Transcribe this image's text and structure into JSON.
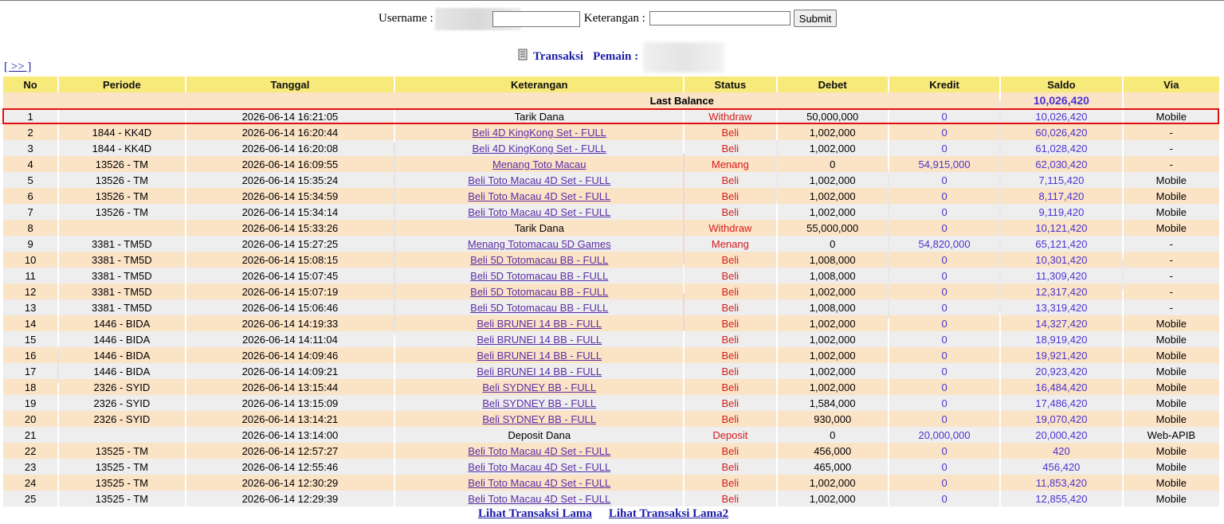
{
  "search": {
    "username_label": "Username :",
    "keterangan_label": "Keterangan :",
    "username_value": "",
    "keterangan_value": "",
    "submit_label": "Submit"
  },
  "title": {
    "transaksi": "Transaksi",
    "pemain": "Pemain :"
  },
  "nav": {
    "next": "[ >> ]"
  },
  "table": {
    "headers": [
      "No",
      "Periode",
      "Tanggal",
      "Keterangan",
      "Status",
      "Debet",
      "Kredit",
      "Saldo",
      "Via"
    ],
    "last_balance_label": "Last Balance",
    "last_balance_value": "10,026,420",
    "rows": [
      {
        "no": "1",
        "periode": "",
        "tanggal": "2026-06-14 16:21:05",
        "ket": "Tarik Dana",
        "link": false,
        "status": "Withdraw",
        "debet": "50,000,000",
        "kredit": "0",
        "saldo": "10,026,420",
        "via": "Mobile"
      },
      {
        "no": "2",
        "periode": "1844 - KK4D",
        "tanggal": "2026-06-14 16:20:44",
        "ket": "Beli 4D KingKong Set - FULL",
        "link": true,
        "status": "Beli",
        "debet": "1,002,000",
        "kredit": "0",
        "saldo": "60,026,420",
        "via": "-"
      },
      {
        "no": "3",
        "periode": "1844 - KK4D",
        "tanggal": "2026-06-14 16:20:08",
        "ket": "Beli 4D KingKong Set - FULL",
        "link": true,
        "status": "Beli",
        "debet": "1,002,000",
        "kredit": "0",
        "saldo": "61,028,420",
        "via": "-"
      },
      {
        "no": "4",
        "periode": "13526 - TM",
        "tanggal": "2026-06-14 16:09:55",
        "ket": "Menang Toto Macau",
        "link": true,
        "status": "Menang",
        "debet": "0",
        "kredit": "54,915,000",
        "saldo": "62,030,420",
        "via": "-"
      },
      {
        "no": "5",
        "periode": "13526 - TM",
        "tanggal": "2026-06-14 15:35:24",
        "ket": "Beli Toto Macau 4D Set - FULL",
        "link": true,
        "status": "Beli",
        "debet": "1,002,000",
        "kredit": "0",
        "saldo": "7,115,420",
        "via": "Mobile"
      },
      {
        "no": "6",
        "periode": "13526 - TM",
        "tanggal": "2026-06-14 15:34:59",
        "ket": "Beli Toto Macau 4D Set - FULL",
        "link": true,
        "status": "Beli",
        "debet": "1,002,000",
        "kredit": "0",
        "saldo": "8,117,420",
        "via": "Mobile"
      },
      {
        "no": "7",
        "periode": "13526 - TM",
        "tanggal": "2026-06-14 15:34:14",
        "ket": "Beli Toto Macau 4D Set - FULL",
        "link": true,
        "status": "Beli",
        "debet": "1,002,000",
        "kredit": "0",
        "saldo": "9,119,420",
        "via": "Mobile"
      },
      {
        "no": "8",
        "periode": "",
        "tanggal": "2026-06-14 15:33:26",
        "ket": "Tarik Dana",
        "link": false,
        "status": "Withdraw",
        "debet": "55,000,000",
        "kredit": "0",
        "saldo": "10,121,420",
        "via": "Mobile"
      },
      {
        "no": "9",
        "periode": "3381 - TM5D",
        "tanggal": "2026-06-14 15:27:25",
        "ket": "Menang Totomacau 5D Games",
        "link": true,
        "status": "Menang",
        "debet": "0",
        "kredit": "54,820,000",
        "saldo": "65,121,420",
        "via": "-"
      },
      {
        "no": "10",
        "periode": "3381 - TM5D",
        "tanggal": "2026-06-14 15:08:15",
        "ket": "Beli 5D Totomacau BB - FULL",
        "link": true,
        "status": "Beli",
        "debet": "1,008,000",
        "kredit": "0",
        "saldo": "10,301,420",
        "via": "-"
      },
      {
        "no": "11",
        "periode": "3381 - TM5D",
        "tanggal": "2026-06-14 15:07:45",
        "ket": "Beli 5D Totomacau BB - FULL",
        "link": true,
        "status": "Beli",
        "debet": "1,008,000",
        "kredit": "0",
        "saldo": "11,309,420",
        "via": "-"
      },
      {
        "no": "12",
        "periode": "3381 - TM5D",
        "tanggal": "2026-06-14 15:07:19",
        "ket": "Beli 5D Totomacau BB - FULL",
        "link": true,
        "status": "Beli",
        "debet": "1,002,000",
        "kredit": "0",
        "saldo": "12,317,420",
        "via": "-"
      },
      {
        "no": "13",
        "periode": "3381 - TM5D",
        "tanggal": "2026-06-14 15:06:46",
        "ket": "Beli 5D Totomacau BB - FULL",
        "link": true,
        "status": "Beli",
        "debet": "1,008,000",
        "kredit": "0",
        "saldo": "13,319,420",
        "via": "-"
      },
      {
        "no": "14",
        "periode": "1446 - BIDA",
        "tanggal": "2026-06-14 14:19:33",
        "ket": "Beli BRUNEI 14 BB - FULL",
        "link": true,
        "status": "Beli",
        "debet": "1,002,000",
        "kredit": "0",
        "saldo": "14,327,420",
        "via": "Mobile"
      },
      {
        "no": "15",
        "periode": "1446 - BIDA",
        "tanggal": "2026-06-14 14:11:04",
        "ket": "Beli BRUNEI 14 BB - FULL",
        "link": true,
        "status": "Beli",
        "debet": "1,002,000",
        "kredit": "0",
        "saldo": "18,919,420",
        "via": "Mobile"
      },
      {
        "no": "16",
        "periode": "1446 - BIDA",
        "tanggal": "2026-06-14 14:09:46",
        "ket": "Beli BRUNEI 14 BB - FULL",
        "link": true,
        "status": "Beli",
        "debet": "1,002,000",
        "kredit": "0",
        "saldo": "19,921,420",
        "via": "Mobile"
      },
      {
        "no": "17",
        "periode": "1446 - BIDA",
        "tanggal": "2026-06-14 14:09:21",
        "ket": "Beli BRUNEI 14 BB - FULL",
        "link": true,
        "status": "Beli",
        "debet": "1,002,000",
        "kredit": "0",
        "saldo": "20,923,420",
        "via": "Mobile"
      },
      {
        "no": "18",
        "periode": "2326 - SYID",
        "tanggal": "2026-06-14 13:15:44",
        "ket": "Beli SYDNEY BB - FULL",
        "link": true,
        "status": "Beli",
        "debet": "1,002,000",
        "kredit": "0",
        "saldo": "16,484,420",
        "via": "Mobile"
      },
      {
        "no": "19",
        "periode": "2326 - SYID",
        "tanggal": "2026-06-14 13:15:09",
        "ket": "Beli SYDNEY BB - FULL",
        "link": true,
        "status": "Beli",
        "debet": "1,584,000",
        "kredit": "0",
        "saldo": "17,486,420",
        "via": "Mobile"
      },
      {
        "no": "20",
        "periode": "2326 - SYID",
        "tanggal": "2026-06-14 13:14:21",
        "ket": "Beli SYDNEY BB - FULL",
        "link": true,
        "status": "Beli",
        "debet": "930,000",
        "kredit": "0",
        "saldo": "19,070,420",
        "via": "Mobile"
      },
      {
        "no": "21",
        "periode": "",
        "tanggal": "2026-06-14 13:14:00",
        "ket": "Deposit Dana",
        "link": false,
        "status": "Deposit",
        "debet": "0",
        "kredit": "20,000,000",
        "saldo": "20,000,420",
        "via": "Web-APIB"
      },
      {
        "no": "22",
        "periode": "13525 - TM",
        "tanggal": "2026-06-14 12:57:27",
        "ket": "Beli Toto Macau 4D Set - FULL",
        "link": true,
        "status": "Beli",
        "debet": "456,000",
        "kredit": "0",
        "saldo": "420",
        "via": "Mobile"
      },
      {
        "no": "23",
        "periode": "13525 - TM",
        "tanggal": "2026-06-14 12:55:46",
        "ket": "Beli Toto Macau 4D Set - FULL",
        "link": true,
        "status": "Beli",
        "debet": "465,000",
        "kredit": "0",
        "saldo": "456,420",
        "via": "Mobile"
      },
      {
        "no": "24",
        "periode": "13525 - TM",
        "tanggal": "2026-06-14 12:30:29",
        "ket": "Beli Toto Macau 4D Set - FULL",
        "link": true,
        "status": "Beli",
        "debet": "1,002,000",
        "kredit": "0",
        "saldo": "11,853,420",
        "via": "Mobile"
      },
      {
        "no": "25",
        "periode": "13525 - TM",
        "tanggal": "2026-06-14 12:29:39",
        "ket": "Beli Toto Macau 4D Set - FULL",
        "link": true,
        "status": "Beli",
        "debet": "1,002,000",
        "kredit": "0",
        "saldo": "12,855,420",
        "via": "Mobile"
      }
    ]
  },
  "footer": {
    "link1": "Lihat Transaksi Lama",
    "link2": "Lihat Transaksi Lama2"
  },
  "colors": {
    "header_bg": "#f7e97a",
    "row_even": "#fbe3c6",
    "row_odd": "#eeeeee",
    "status_red": "#d21c1c",
    "value_blue": "#4a34d0",
    "link_blue": "#1b1ba8",
    "highlight_border": "#e01010"
  },
  "icons": {
    "title_icon": "document-icon"
  }
}
